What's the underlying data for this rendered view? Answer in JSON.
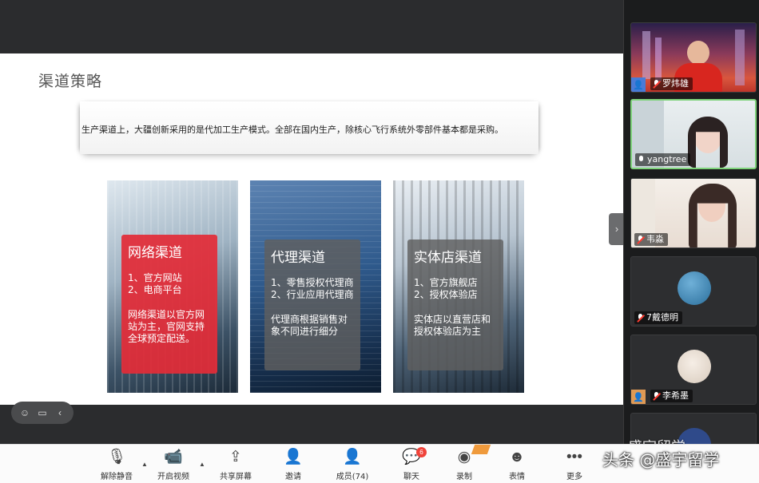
{
  "slide": {
    "title": "渠道策略",
    "quote": "生产渠道上，大疆创新采用的是代加工生产模式。全部在国内生产，除核心飞行系统外零部件基本都是采购。",
    "cards": [
      {
        "title": "网络渠道",
        "items": [
          "1、官方网站",
          "2、电商平台"
        ],
        "desc": [
          "网络渠道以官方网",
          "站为主，官网支持",
          "全球预定配送。"
        ],
        "panel_color": "#e22c38"
      },
      {
        "title": "代理渠道",
        "items": [
          "1、零售授权代理商",
          "2、行业应用代理商"
        ],
        "desc": [
          "代理商根据销售对",
          "象不同进行细分"
        ],
        "panel_color": "#5f5f5f"
      },
      {
        "title": "实体店渠道",
        "items": [
          "1、官方旗舰店",
          "2、授权体验店"
        ],
        "desc": [
          "实体店以直营店和",
          "授权体验店为主"
        ],
        "panel_color": "#5f5f5f"
      }
    ]
  },
  "participants": [
    {
      "name": "罗炜雄",
      "muted": true
    },
    {
      "name": "yangtree",
      "muted": false
    },
    {
      "name": "韦淼",
      "muted": true
    },
    {
      "name": "7戴德明",
      "muted": true
    },
    {
      "name": "李希墨",
      "muted": true
    }
  ],
  "toolbar": {
    "unmute": "解除静音",
    "start_video": "开启视频",
    "share_screen": "共享屏幕",
    "invite": "邀请",
    "members": "成员(74)",
    "chat": "聊天",
    "chat_badge": "6",
    "record": "录制",
    "reactions": "表情",
    "more": "更多"
  },
  "watermark": {
    "main": "头条 @盛宇留学",
    "top": "盛宇留学"
  },
  "colors": {
    "active_speaker": "#7ed37a",
    "badge": "#f0433a",
    "red_panel": "#e22c38"
  }
}
